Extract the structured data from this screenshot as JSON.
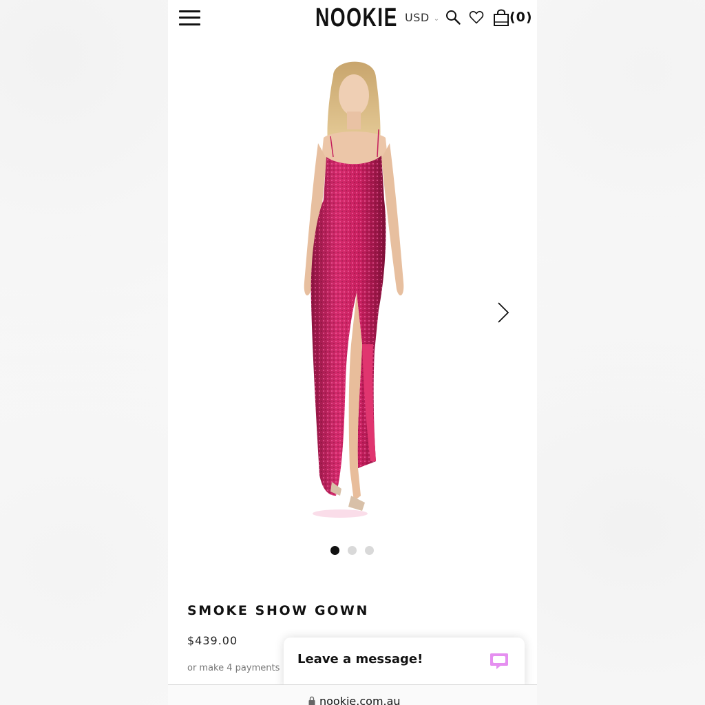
{
  "header": {
    "brand": "NOOKIE",
    "currency": "USD",
    "cart_count": "(0)",
    "icons": [
      "hamburger-menu-icon",
      "chevron-down-icon",
      "search-icon",
      "heart-icon",
      "shopping-bag-icon"
    ]
  },
  "gallery": {
    "dot_count": 3,
    "active_index": 0,
    "next_icon": "chevron-right-icon",
    "dress_color": "#c41e5c"
  },
  "product": {
    "title": "SMOKE SHOW GOWN",
    "price": "$439.00",
    "payments_text": "or make 4 payments"
  },
  "chat": {
    "label": "Leave a message!",
    "icon": "chat-bubble-icon",
    "accent": "#e58ff0"
  },
  "browser": {
    "url": "nookie.com.au",
    "icon": "lock-icon"
  }
}
